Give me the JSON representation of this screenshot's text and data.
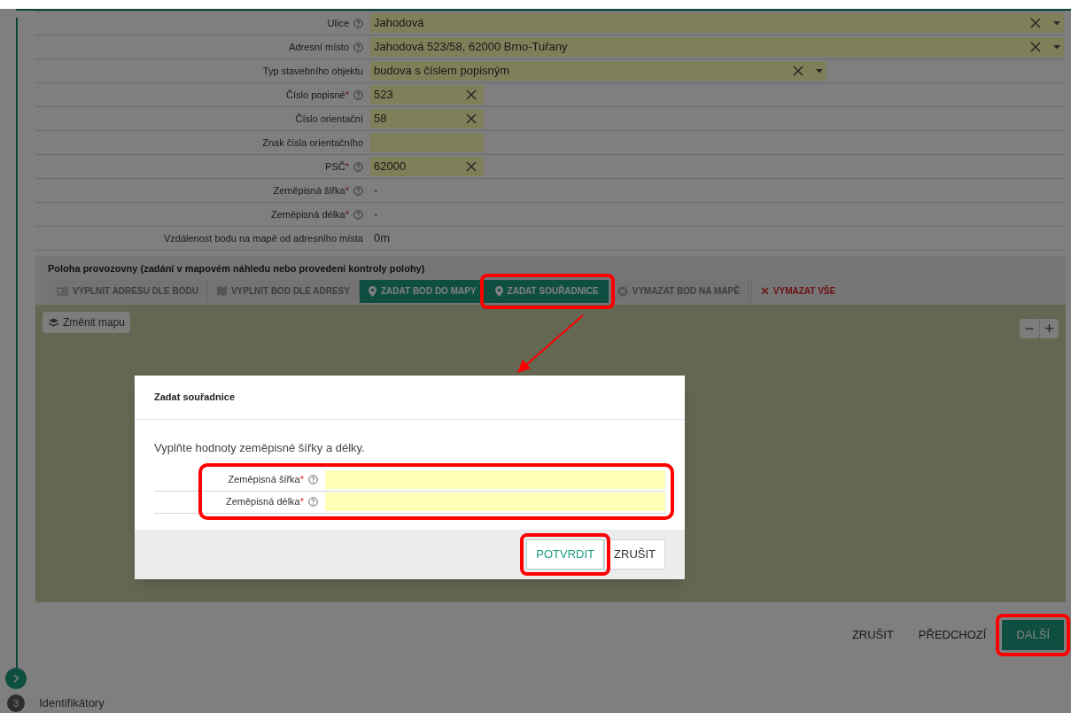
{
  "form_rows": [
    {
      "label": "Ulice",
      "help": true,
      "kind": "combo-wide",
      "value": "Jahodová"
    },
    {
      "label": "Adresní místo",
      "help": true,
      "kind": "combo-wide",
      "value": "Jahodová 523/58, 62000 Brno-Tuřany"
    },
    {
      "label": "Typ stavebního objektu",
      "help": false,
      "kind": "combo",
      "value": "budova s číslem popisným"
    },
    {
      "label": "Číslo popisné",
      "required_mark": "*",
      "help": true,
      "kind": "text",
      "value": "523"
    },
    {
      "label": "Číslo orientační",
      "help": false,
      "kind": "text",
      "value": "58"
    },
    {
      "label": "Znak čísla orientačního",
      "help": false,
      "kind": "text"
    },
    {
      "label": "PSČ",
      "required_mark": "*",
      "help": true,
      "kind": "text",
      "value": "62000"
    },
    {
      "label": "Zeměpisná šířka",
      "required_mark": "*",
      "help": true,
      "kind": "plain",
      "value": "-"
    },
    {
      "label": "Zeměpisná délka",
      "required_mark": "*",
      "help": true,
      "kind": "plain",
      "value": "-"
    },
    {
      "label": "Vzdálenost bodu na mapě od adresního místa",
      "help": false,
      "kind": "plain",
      "value": "0m"
    }
  ],
  "location_section": {
    "title": "Poloha provozovny (zadání v mapovém náhledu nebo provedení kontroly polohy)",
    "tools": [
      {
        "label": "VYPLNIT ADRESU DLE BODU",
        "kind": "disabled",
        "highlighted": false
      },
      {
        "label": "VYPLNIT BOD DLE ADRESY",
        "kind": "disabled",
        "highlighted": false
      },
      {
        "label": "ZADAT BOD DO MAPY",
        "kind": "primary",
        "highlighted": false
      },
      {
        "label": "ZADAT SOUŘADNICE",
        "kind": "primary",
        "highlighted": true
      },
      {
        "label": "VYMAZAT BOD NA MAPĚ",
        "kind": "disabled",
        "highlighted": false
      },
      {
        "label": "VYMAZAT VŠE",
        "kind": "danger",
        "highlighted": false
      }
    ]
  },
  "map": {
    "change_map_button": "Změnit mapu",
    "zoom_out": "−",
    "zoom_in": "+"
  },
  "footer_buttons": [
    {
      "label": "ZRUŠIT",
      "kind": "text",
      "highlighted": false
    },
    {
      "label": "PŘEDCHOZÍ",
      "kind": "text",
      "highlighted": false
    },
    {
      "label": "DALŠÍ",
      "kind": "primary",
      "highlighted": true
    }
  ],
  "steps": [
    {
      "kind": "current"
    },
    {
      "kind": "numbered",
      "number": "3",
      "label": "Identifikátory"
    }
  ],
  "modal_open": true,
  "annotation_arrow": true,
  "dialog": {
    "title": "Zadat souřadnice",
    "message": "Vyplňte hodnoty zeměpisné šířky a délky.",
    "fields_highlighted": true,
    "fields": [
      {
        "label": "Zeměpisná šířka",
        "required_mark": "*",
        "help": true
      },
      {
        "label": "Zeměpisná délka",
        "required_mark": "*",
        "help": true
      }
    ],
    "buttons": [
      {
        "label": "POTVRDIT",
        "kind": "primary",
        "highlighted": true
      },
      {
        "label": "ZRUŠIT",
        "kind": "default",
        "highlighted": false
      }
    ]
  }
}
